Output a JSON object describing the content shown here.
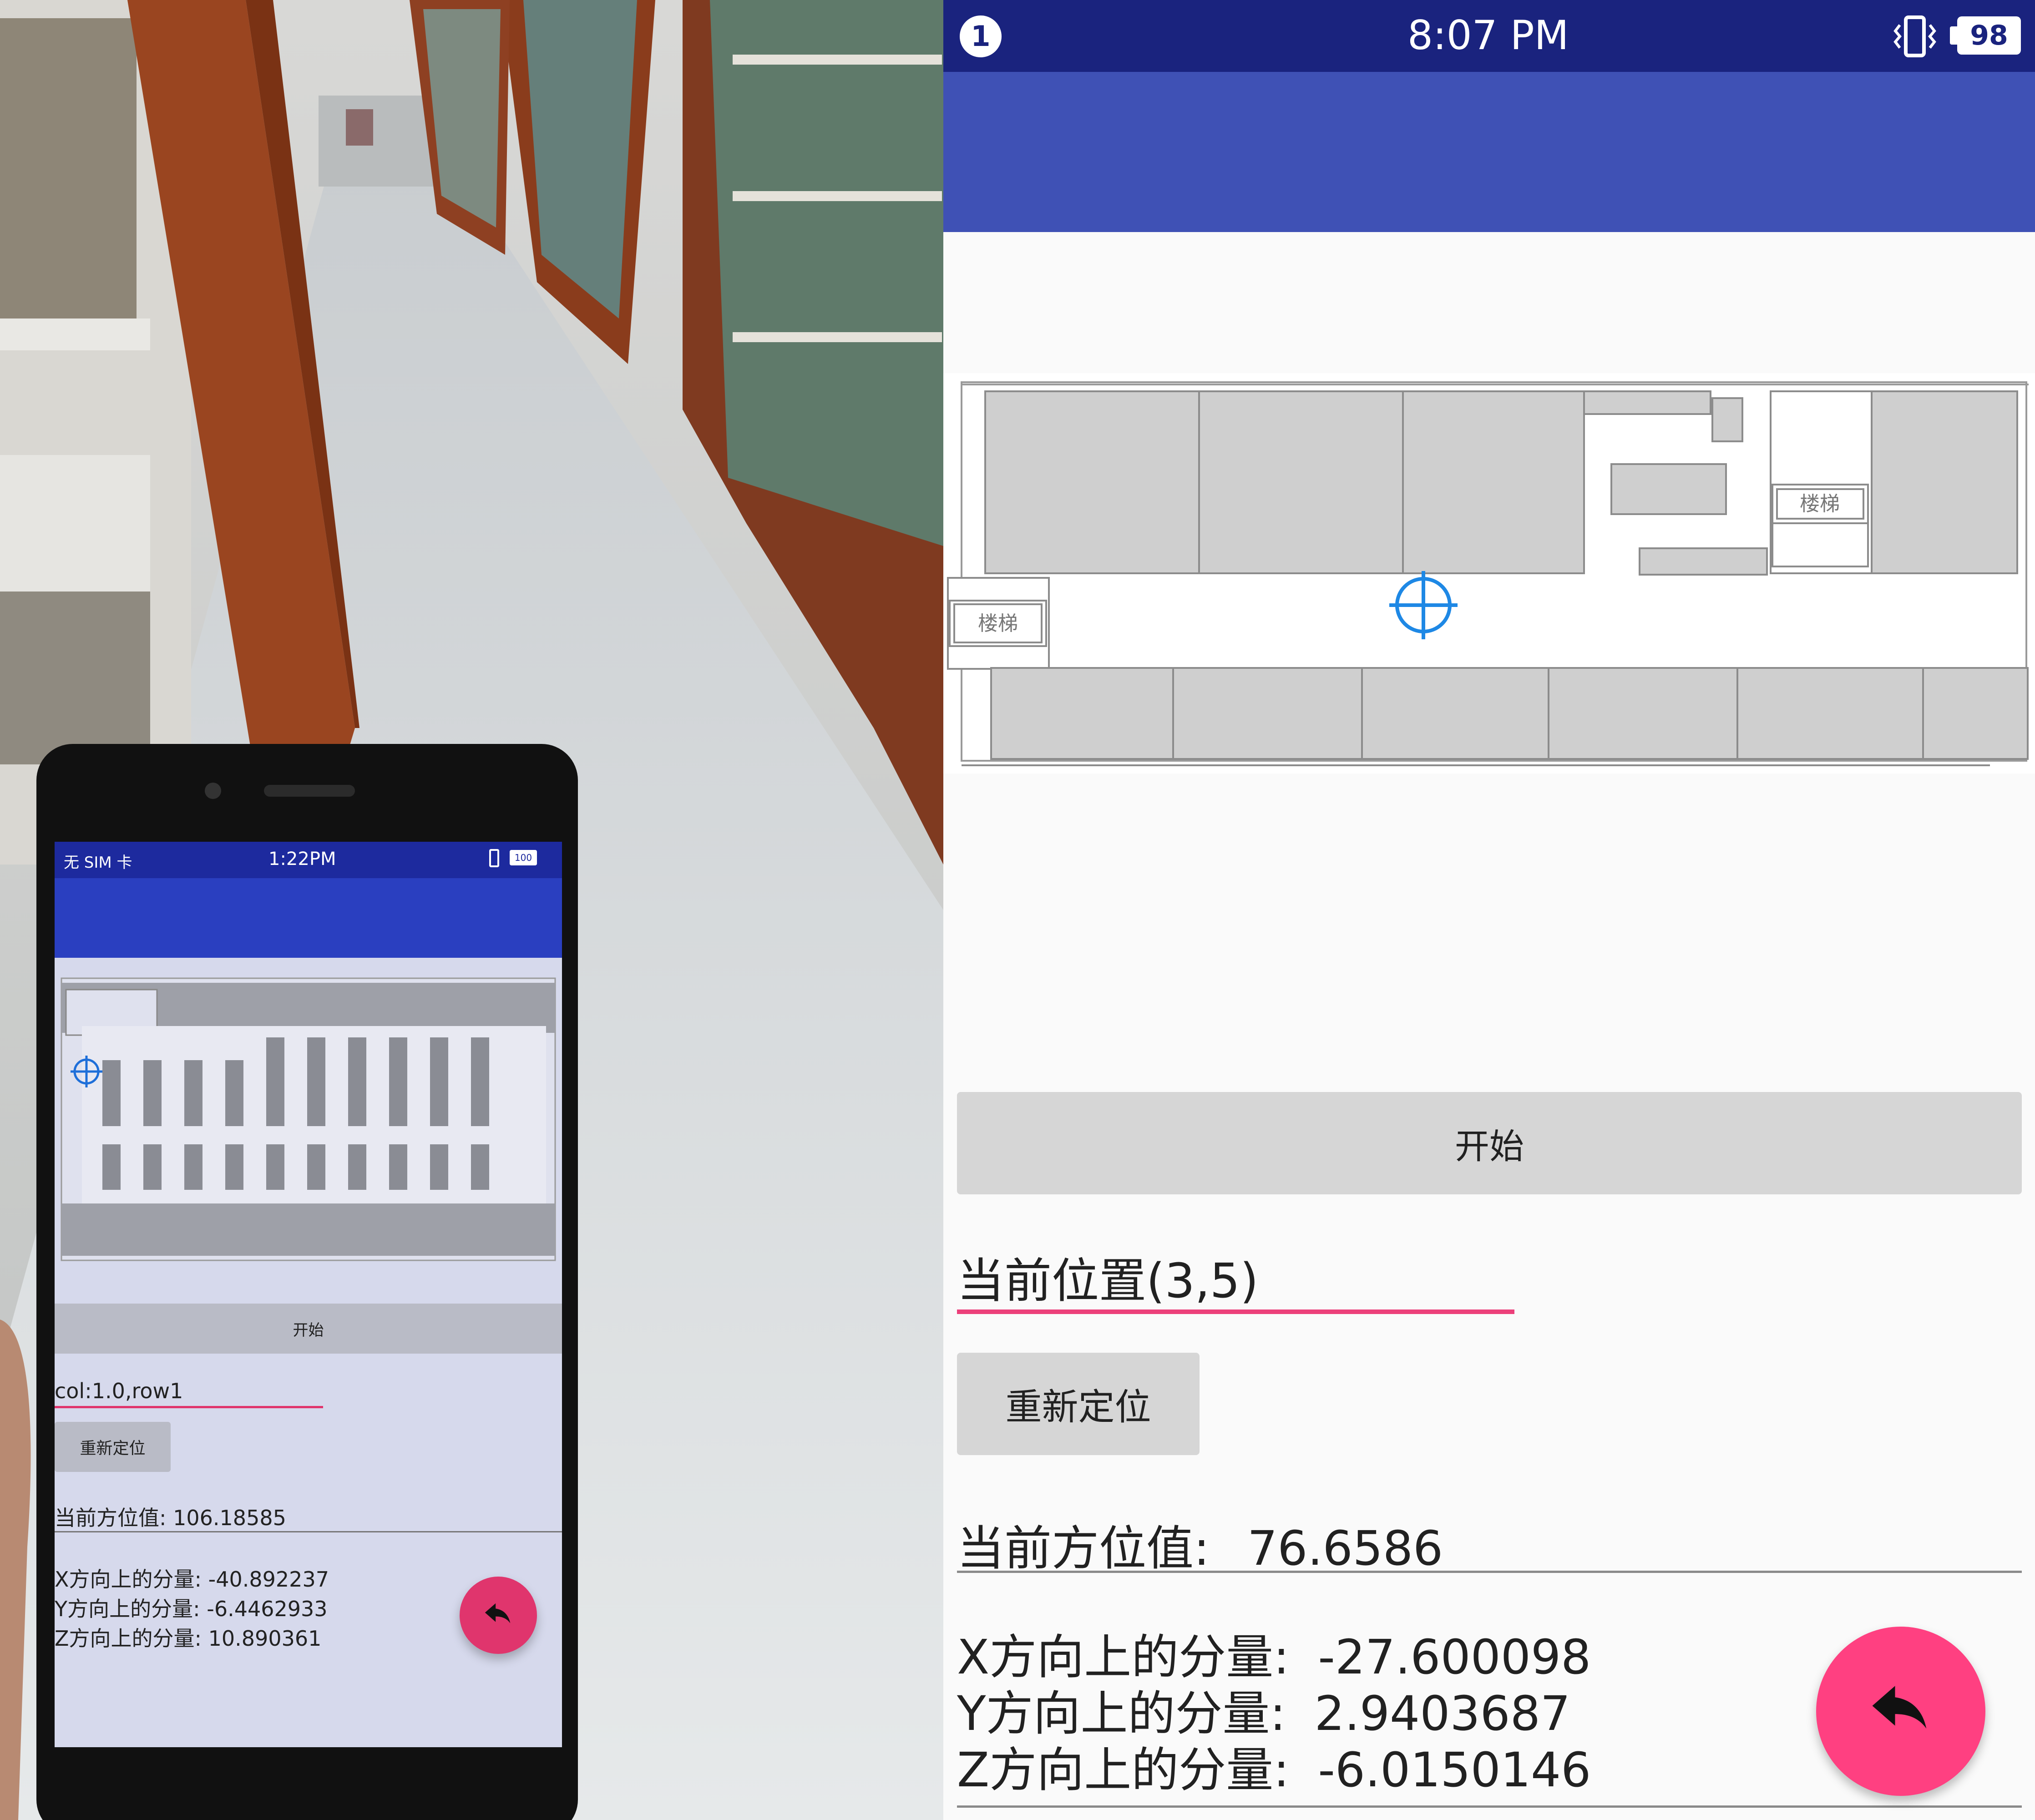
{
  "status_bar": {
    "notification_count": "1",
    "time": "8:07 PM",
    "battery": "98"
  },
  "map": {
    "stair_label_left": "楼梯",
    "stair_label_right": "楼梯"
  },
  "start_button_label": "开始",
  "current_position": "当前位置(3,5)",
  "relocate_button_label": "重新定位",
  "orientation": {
    "label": "当前方位值:",
    "value": "76.6586"
  },
  "components": [
    {
      "label": "X方向上的分量:",
      "value": "-27.600098"
    },
    {
      "label": "Y方向上的分量:",
      "value": "2.9403687"
    },
    {
      "label": "Z方向上的分量:",
      "value": "-6.0150146"
    }
  ],
  "phone_photo": {
    "status_carrier": "无 SIM 卡",
    "status_time": "1:22PM",
    "status_battery": "100",
    "start_button_label": "开始",
    "position_text": "col:1.0,row1",
    "relocate_button_label": "重新定位",
    "orientation": "当前方位值:  106.18585",
    "x_component": "X方向上的分量:  -40.892237",
    "y_component": "Y方向上的分量:  -6.4462933",
    "z_component": "Z方向上的分量:  10.890361"
  },
  "colors": {
    "status_bar": "#1a237e",
    "toolbar": "#3f51b5",
    "accent": "#ff4081",
    "button": "#d6d6d6",
    "map_room": "#cfcfcf",
    "locator": "#1e88e5"
  }
}
